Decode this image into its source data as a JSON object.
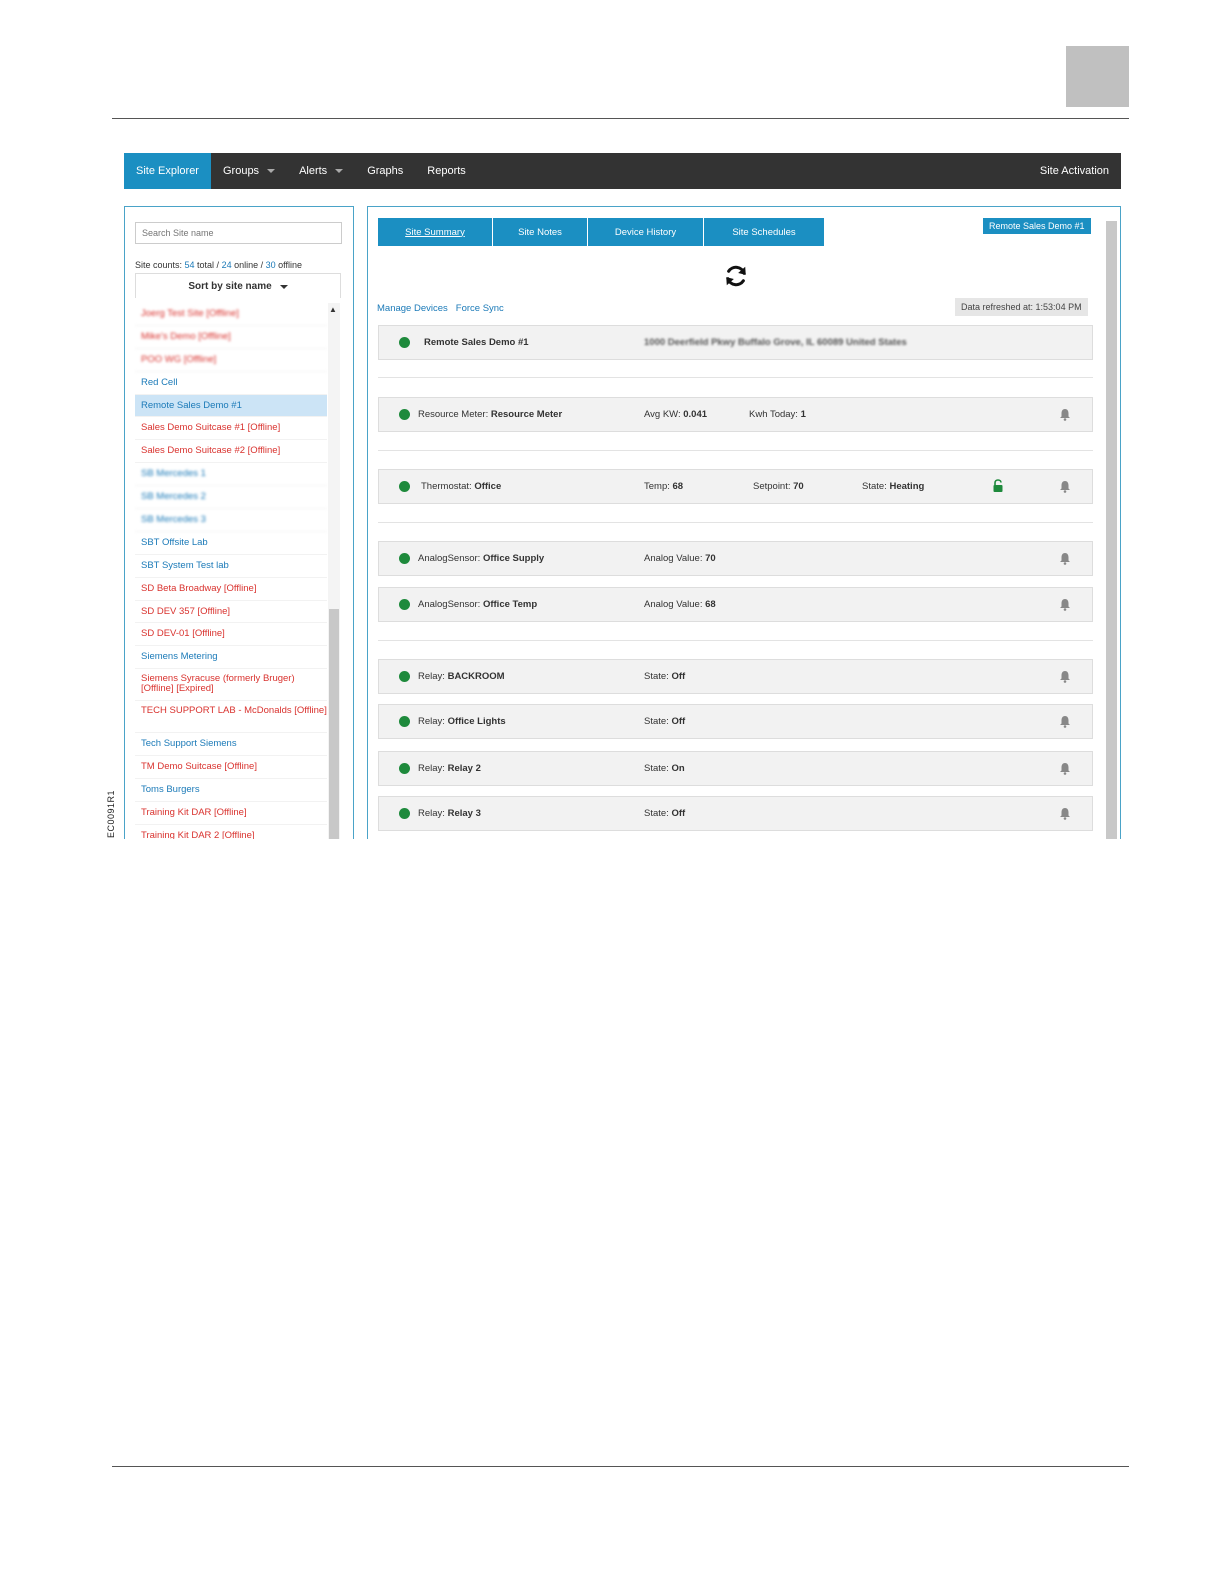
{
  "page": {
    "figure_code": "EC0091R1"
  },
  "navbar": {
    "items": [
      "Site Explorer",
      "Groups",
      "Alerts",
      "Graphs",
      "Reports"
    ],
    "right": "Site Activation"
  },
  "left": {
    "search_placeholder": "Search Site name",
    "counts": {
      "prefix": "Site counts: ",
      "total": "54",
      "total_label": " total / ",
      "online": "24",
      "online_label": " online / ",
      "offline": "30",
      "offline_label": " offline"
    },
    "sort_label": "Sort by site name",
    "sites": [
      "Joerg Test Site [Offline]",
      "Mike's Demo [Offline]",
      "POO WG [Offline]",
      "Red Cell",
      "Remote Sales Demo #1",
      "Sales Demo Suitcase #1 [Offline]",
      "Sales Demo Suitcase #2 [Offline]",
      "SB Mercedes 1",
      "SB Mercedes 2",
      "SB Mercedes 3",
      "SBT Offsite Lab",
      "SBT System Test lab",
      "SD Beta Broadway [Offline]",
      "SD DEV 357 [Offline]",
      "SD DEV-01 [Offline]",
      "Siemens Metering",
      "Siemens Syracuse (formerly Bruger) [Offline] [Expired]",
      "TECH SUPPORT LAB - McDonalds [Offline]",
      "Tech Support Siemens",
      "TM Demo Suitcase [Offline]",
      "Toms Burgers",
      "Training Kit DAR [Offline]",
      "Training Kit DAR 2 [Offline]"
    ]
  },
  "right": {
    "tabs": [
      "Site Summary",
      "Site Notes",
      "Device History",
      "Site Schedules"
    ],
    "site_badge": "Remote Sales Demo #1",
    "links": [
      "Manage Devices",
      "Force Sync"
    ],
    "refreshed": "Data refreshed at: 1:53:04 PM",
    "site_row": {
      "name": "Remote Sales Demo #1",
      "address": "1000 Deerfield Pkwy Buffalo Grove, IL 60089 United States"
    },
    "devices": {
      "resource": {
        "type": "Resource Meter: ",
        "name": "Resource Meter",
        "c1_label": "Avg KW: ",
        "c1_value": "0.041",
        "c2_label": "Kwh Today: ",
        "c2_value": "1"
      },
      "thermostat": {
        "type": "Thermostat: ",
        "name": "Office",
        "c1_label": "Temp: ",
        "c1_value": "68",
        "c2_label": "Setpoint: ",
        "c2_value": "70",
        "c3_label": "State: ",
        "c3_value": "Heating"
      },
      "analog1": {
        "type": "AnalogSensor: ",
        "name": "Office Supply",
        "c1_label": "Analog Value: ",
        "c1_value": "70"
      },
      "analog2": {
        "type": "AnalogSensor: ",
        "name": "Office Temp",
        "c1_label": "Analog Value: ",
        "c1_value": "68"
      },
      "relay1": {
        "type": "Relay: ",
        "name": "BACKROOM",
        "c1_label": "State: ",
        "c1_value": "Off"
      },
      "relay2": {
        "type": "Relay: ",
        "name": "Office Lights",
        "c1_label": "State: ",
        "c1_value": "Off"
      },
      "relay3": {
        "type": "Relay: ",
        "name": "Relay 2",
        "c1_label": "State: ",
        "c1_value": "On"
      },
      "relay4": {
        "type": "Relay: ",
        "name": "Relay 3",
        "c1_label": "State: ",
        "c1_value": "Off"
      }
    }
  },
  "colors": {
    "accent": "#1b8fc2",
    "navbar": "#333333",
    "online_dot": "#1e8a3c",
    "offline_text": "#d9322e",
    "online_text": "#1b7ab8",
    "selected_row": "#cce4f6"
  }
}
